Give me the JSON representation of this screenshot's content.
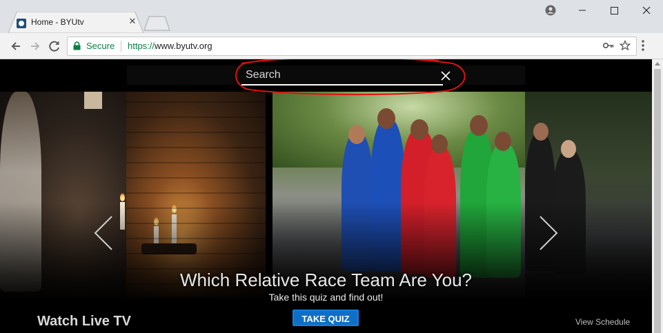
{
  "browser": {
    "tab_title": "Home - BYUtv",
    "secure_label": "Secure",
    "url_scheme": "https://",
    "url_host": "www.byutv.org"
  },
  "search": {
    "placeholder": "Search"
  },
  "hero": {
    "title": "Which Relative Race Team Are You?",
    "subtitle": "Take this quiz and find out!",
    "cta_label": "TAKE QUIZ"
  },
  "sections": {
    "live_heading": "Watch Live TV",
    "schedule_link": "View Schedule"
  },
  "colors": {
    "cta": "#0f6fc6",
    "secure_green": "#0b8043",
    "annotation_red": "#e01010"
  }
}
